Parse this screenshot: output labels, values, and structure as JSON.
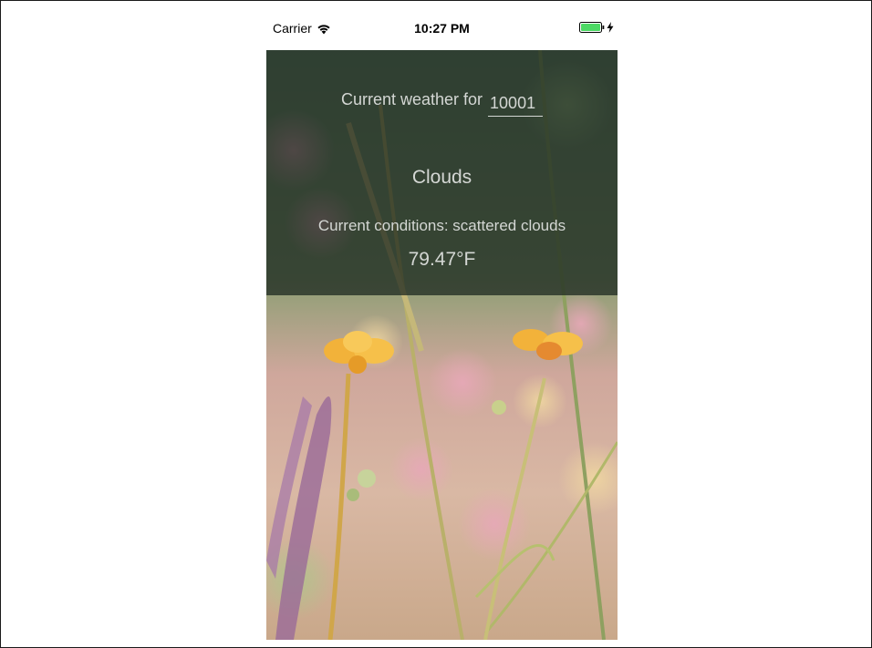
{
  "status_bar": {
    "carrier": "Carrier",
    "time": "10:27 PM",
    "wifi_icon": "wifi-icon",
    "battery_icon": "battery-icon",
    "charging_icon": "bolt-icon",
    "battery_color": "#4cd964"
  },
  "weather": {
    "zip_label": "Current weather for",
    "zip_value": "10001",
    "main": "Clouds",
    "description": "Current conditions: scattered clouds",
    "temperature": "79.47°F"
  },
  "colors": {
    "overlay": "#18221c",
    "text": "#d4d7d4"
  }
}
